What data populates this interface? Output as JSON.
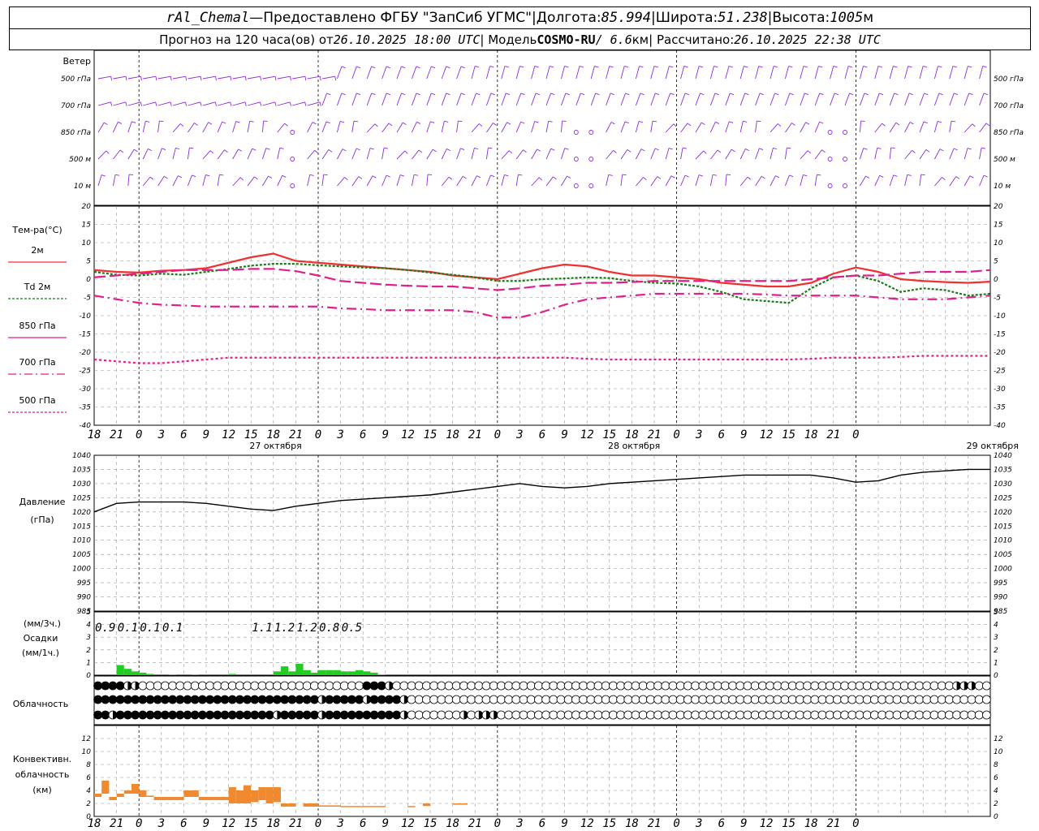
{
  "header": {
    "station": "rAl_Chemal",
    "dash": " — ",
    "provider": "Предоставлено ФГБУ \"ЗапСиб УГМС\"",
    "sep": " | ",
    "lon_label": "Долгота: ",
    "lon": "85.994",
    "lat_label": "Широта: ",
    "lat": "51.238",
    "alt_label": "Высота: ",
    "alt": "1005",
    "alt_unit": "м",
    "forecast_label": "Прогноз на 120 часа(ов) от ",
    "forecast_time": "26.10.2025 18:00 UTC",
    "model_label": " | Модель ",
    "model": "COSMO-RU",
    "model_res": " / 6.6",
    "model_res_unit": "км",
    "calc_label": " | Рассчитано: ",
    "calc_time": "26.10.2025 22:38 UTC"
  },
  "wind_panel": {
    "title": "Ветер",
    "levels": [
      "500 гПа",
      "700 гПа",
      "850 гПа",
      "500 м",
      "10 м"
    ]
  },
  "temp_panel": {
    "title": "Тем-ра(°C)",
    "legend": [
      {
        "label": "2м",
        "color": "#f03030",
        "dash": "solid"
      },
      {
        "label": "Td 2м",
        "color": "#1a7a1a",
        "dash": "dotted"
      },
      {
        "label": "850 гПа",
        "color": "#e0208a",
        "dash": "solid"
      },
      {
        "label": "700 гПа",
        "color": "#e0208a",
        "dash": "dashdot"
      },
      {
        "label": "500 гПа",
        "color": "#e0208a",
        "dash": "dotted"
      }
    ]
  },
  "pressure_panel": {
    "title": "Давление",
    "unit": "(гПа)"
  },
  "precip_panel": {
    "unit1": "(мм/3ч.)",
    "title": "Осадки",
    "unit2": "(мм/1ч.)"
  },
  "cloud_panel": {
    "title": "Облачность"
  },
  "conv_panel": {
    "title1": "Конвективн.",
    "title2": "облачность",
    "unit": "(км)"
  },
  "time_axis": {
    "hour_labels": [
      "18",
      "21",
      "0",
      "3",
      "6",
      "9",
      "12",
      "15",
      "18",
      "21",
      "0",
      "3",
      "6",
      "9",
      "12",
      "15",
      "18",
      "21",
      "0",
      "3",
      "6",
      "9",
      "12",
      "15",
      "18",
      "21",
      "0",
      "3",
      "6",
      "9",
      "12",
      "15",
      "18",
      "21",
      "0"
    ],
    "day_labels": [
      "27 октября",
      "28 октября",
      "29 октября"
    ]
  },
  "chart_data": [
    {
      "type": "line",
      "title": "Тем-ра(°C)",
      "x_hours": [
        0,
        3,
        6,
        9,
        12,
        15,
        18,
        21,
        24,
        27,
        30,
        33,
        36,
        39,
        42,
        45,
        48,
        51,
        54,
        57,
        60,
        63,
        66,
        69,
        72,
        75,
        78,
        81,
        84,
        87,
        90,
        93,
        96,
        99,
        102,
        105,
        108,
        111,
        114,
        117,
        120
      ],
      "ylim": [
        -40,
        20
      ],
      "yticks": [
        20,
        15,
        10,
        5,
        0,
        -5,
        -10,
        -15,
        -20,
        -25,
        -30,
        -35,
        -40
      ],
      "series": [
        {
          "name": "2м",
          "values": [
            2.5,
            2,
            1.8,
            2.3,
            2.5,
            3,
            4.5,
            6,
            7,
            5,
            4.5,
            4,
            3.5,
            3,
            2.5,
            2,
            1,
            0.5,
            0,
            1.5,
            3,
            4,
            3.5,
            2,
            1,
            1,
            0.5,
            0,
            -1,
            -1.5,
            -2,
            -2,
            -1,
            1.5,
            3.2,
            2,
            0,
            -0.5,
            -0.8,
            -1,
            -0.7
          ]
        },
        {
          "name": "Td 2м",
          "values": [
            2,
            1.2,
            1,
            1.5,
            1.2,
            2,
            2.8,
            3.7,
            4.2,
            4.2,
            3.8,
            3.5,
            3.2,
            3,
            2.5,
            1.8,
            1.2,
            0.5,
            -0.5,
            -0.5,
            0,
            0.2,
            0.5,
            0.3,
            -0.5,
            -1,
            -1.2,
            -2,
            -3.5,
            -5.5,
            -6,
            -6.5,
            -2.5,
            0.5,
            1,
            -0.5,
            -3.5,
            -2.5,
            -3,
            -4.5,
            -4
          ]
        },
        {
          "name": "850 гПа",
          "values": [
            0.5,
            1,
            1.5,
            2,
            2.5,
            2.5,
            2.5,
            2.8,
            2.8,
            2.2,
            1,
            -0.5,
            -1,
            -1.5,
            -1.8,
            -2,
            -2,
            -2.5,
            -3,
            -2.5,
            -1.8,
            -1.5,
            -1,
            -1,
            -0.8,
            -0.5,
            -0.5,
            -0.5,
            -0.5,
            -0.5,
            -0.5,
            -0.5,
            0,
            0.5,
            1,
            1,
            1.5,
            2,
            2,
            2,
            2.5
          ]
        },
        {
          "name": "700 гПа",
          "values": [
            -4.5,
            -5.5,
            -6.5,
            -7,
            -7.2,
            -7.5,
            -7.5,
            -7.5,
            -7.5,
            -7.5,
            -7.5,
            -8,
            -8.2,
            -8.5,
            -8.5,
            -8.5,
            -8.5,
            -9,
            -10.5,
            -10.5,
            -9,
            -7,
            -5.5,
            -5,
            -4.5,
            -4,
            -4,
            -4,
            -4,
            -4,
            -4.2,
            -4.5,
            -4.5,
            -4.5,
            -4.5,
            -5,
            -5.5,
            -5.5,
            -5.5,
            -5,
            -4.5
          ]
        },
        {
          "name": "500 гПа",
          "values": [
            -22,
            -22.5,
            -23,
            -23,
            -22.5,
            -22,
            -21.5,
            -21.5,
            -21.5,
            -21.5,
            -21.5,
            -21.5,
            -21.5,
            -21.5,
            -21.5,
            -21.5,
            -21.5,
            -21.5,
            -21.5,
            -21.5,
            -21.5,
            -21.5,
            -21.8,
            -22,
            -22,
            -22,
            -22,
            -22,
            -22,
            -22,
            -22,
            -22,
            -21.8,
            -21.5,
            -21.5,
            -21.5,
            -21.3,
            -21,
            -21,
            -21,
            -21
          ]
        }
      ]
    },
    {
      "type": "line",
      "title": "Давление",
      "x_hours": [
        0,
        3,
        6,
        9,
        12,
        15,
        18,
        21,
        24,
        27,
        30,
        33,
        36,
        39,
        42,
        45,
        48,
        51,
        54,
        57,
        60,
        63,
        66,
        69,
        72,
        75,
        78,
        81,
        84,
        87,
        90,
        93,
        96,
        99,
        102,
        105,
        108,
        111,
        114,
        117,
        120
      ],
      "ylim": [
        985,
        1040
      ],
      "yticks": [
        1040,
        1035,
        1030,
        1025,
        1020,
        1015,
        1010,
        1005,
        1000,
        995,
        990,
        985
      ],
      "series": [
        {
          "name": "Давление",
          "values": [
            1020,
            1023,
            1023.5,
            1023.5,
            1023.5,
            1023,
            1022,
            1021,
            1020.5,
            1022,
            1023,
            1024,
            1024.5,
            1025,
            1025.5,
            1026,
            1027,
            1028,
            1029,
            1030,
            1029,
            1028.5,
            1029,
            1030,
            1030.5,
            1031,
            1031.5,
            1032,
            1032.5,
            1033,
            1033,
            1033,
            1033,
            1032,
            1030.5,
            1031,
            1033,
            1034,
            1034.5,
            1035,
            1035
          ]
        }
      ]
    },
    {
      "type": "bar",
      "title": "Осадки",
      "ylim": [
        0,
        5
      ],
      "yticks": [
        5,
        4,
        3,
        2,
        1,
        0
      ],
      "x_hours_hourly": [
        0,
        1,
        2,
        3,
        4,
        5,
        6,
        7,
        8,
        9,
        10,
        11,
        12,
        13,
        14,
        15,
        16,
        17,
        18,
        19,
        20,
        21,
        22,
        23,
        24,
        25,
        26,
        27,
        28,
        29,
        30,
        31,
        32,
        33,
        34,
        35,
        36,
        37,
        38,
        39,
        40,
        41,
        42,
        43,
        44,
        45,
        46,
        47,
        48,
        49,
        50,
        51,
        52,
        53,
        54,
        55,
        56,
        57,
        58,
        59,
        60,
        61,
        62,
        63,
        64,
        65,
        66,
        67,
        68,
        69,
        70
      ],
      "values_hourly": [
        0,
        0,
        0.8,
        0.5,
        0.3,
        0.2,
        0.1,
        0,
        0,
        0,
        0,
        0,
        0,
        0,
        0,
        0,
        0,
        0,
        0,
        0,
        0,
        0,
        0,
        0,
        0,
        0,
        0,
        0,
        0,
        0,
        0,
        0,
        0,
        0,
        0,
        0,
        0,
        0,
        0,
        0,
        0,
        0,
        0,
        0,
        0,
        0,
        0,
        0,
        0,
        0,
        0,
        0,
        0,
        0,
        0,
        0,
        0,
        0,
        0,
        0,
        0,
        0,
        0,
        0,
        0,
        0,
        0,
        0,
        0,
        0,
        0
      ],
      "annotations_3h": [
        {
          "hour": 1.5,
          "label": "0.9"
        },
        {
          "hour": 4.5,
          "label": "0.1"
        },
        {
          "hour": 7.5,
          "label": "0.1"
        },
        {
          "hour": 10.5,
          "label": "0.1"
        },
        {
          "hour": 22.5,
          "label": "1.1"
        },
        {
          "hour": 25.5,
          "label": "1.2"
        },
        {
          "hour": 28.5,
          "label": "1.2"
        },
        {
          "hour": 31.5,
          "label": "0.8"
        },
        {
          "hour": 34.5,
          "label": "0.5"
        }
      ]
    },
    {
      "type": "bar",
      "title": "Конвективн. облачность",
      "ylim": [
        0,
        14
      ],
      "yticks": [
        12,
        10,
        8,
        6,
        4,
        2,
        0
      ],
      "segments": [
        {
          "from": 0,
          "to": 1,
          "bottom": 3,
          "top": 3.5
        },
        {
          "from": 1,
          "to": 2,
          "bottom": 3.5,
          "top": 5.5
        },
        {
          "from": 2,
          "to": 3,
          "bottom": 2.5,
          "top": 3
        },
        {
          "from": 3,
          "to": 4,
          "bottom": 3,
          "top": 3.5
        },
        {
          "from": 4,
          "to": 5,
          "bottom": 3.5,
          "top": 4
        },
        {
          "from": 5,
          "to": 6,
          "bottom": 3.5,
          "top": 5
        },
        {
          "from": 6,
          "to": 7,
          "bottom": 3,
          "top": 4
        },
        {
          "from": 7,
          "to": 8,
          "bottom": 3,
          "top": 3.2
        },
        {
          "from": 8,
          "to": 9,
          "bottom": 2.5,
          "top": 3
        },
        {
          "from": 9,
          "to": 12,
          "bottom": 2.5,
          "top": 3
        },
        {
          "from": 12,
          "to": 14,
          "bottom": 3,
          "top": 4
        },
        {
          "from": 14,
          "to": 15,
          "bottom": 2.5,
          "top": 3
        },
        {
          "from": 15,
          "to": 18,
          "bottom": 2.5,
          "top": 3
        },
        {
          "from": 18,
          "to": 19,
          "bottom": 2,
          "top": 4.5
        },
        {
          "from": 19,
          "to": 20,
          "bottom": 2,
          "top": 4
        },
        {
          "from": 20,
          "to": 21,
          "bottom": 2,
          "top": 4.8
        },
        {
          "from": 21,
          "to": 22,
          "bottom": 2.2,
          "top": 4
        },
        {
          "from": 22,
          "to": 23,
          "bottom": 2.5,
          "top": 4.5
        },
        {
          "from": 23,
          "to": 24,
          "bottom": 2,
          "top": 4.5
        },
        {
          "from": 24,
          "to": 25,
          "bottom": 2.2,
          "top": 4.5
        },
        {
          "from": 25,
          "to": 26,
          "bottom": 1.5,
          "top": 2
        },
        {
          "from": 26,
          "to": 27,
          "bottom": 1.5,
          "top": 2
        },
        {
          "from": 28,
          "to": 30,
          "bottom": 1.5,
          "top": 2
        },
        {
          "from": 30,
          "to": 33,
          "bottom": 1.5,
          "top": 1.7
        },
        {
          "from": 33,
          "to": 36,
          "bottom": 1.5,
          "top": 1.6
        },
        {
          "from": 36,
          "to": 39,
          "bottom": 1.5,
          "top": 1.6
        },
        {
          "from": 42,
          "to": 43,
          "bottom": 1.5,
          "top": 1.6
        },
        {
          "from": 44,
          "to": 45,
          "bottom": 1.6,
          "top": 2
        },
        {
          "from": 48,
          "to": 50,
          "bottom": 1.8,
          "top": 2
        }
      ]
    }
  ],
  "colors": {
    "wind": "#8a2be2",
    "t2m": "#f03030",
    "td": "#1a7a1a",
    "upper": "#e0208a",
    "precip": "#22cc22",
    "conv": "#f08a30",
    "grid": "#999999"
  }
}
